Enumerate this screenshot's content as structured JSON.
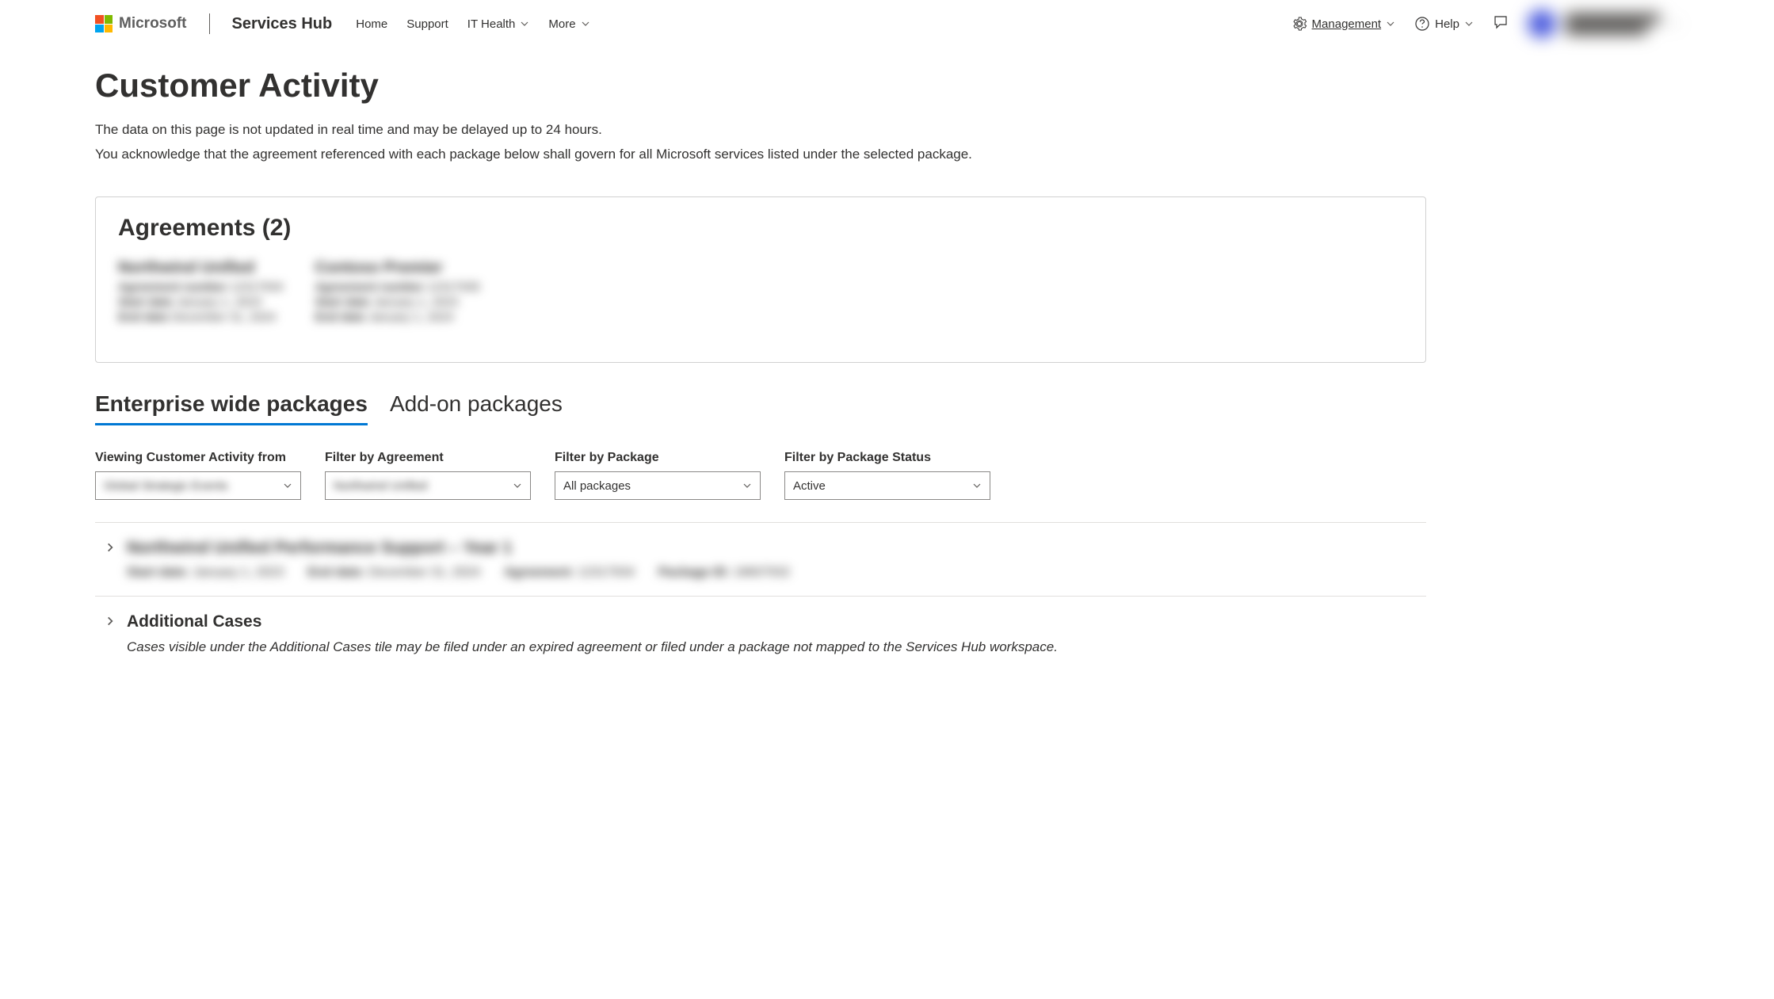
{
  "header": {
    "brand": "Microsoft",
    "app_name": "Services Hub",
    "nav": {
      "home": "Home",
      "support": "Support",
      "it_health": "IT Health",
      "more": "More",
      "management": "Management",
      "help": "Help"
    },
    "profile": {
      "line1": "██████████████",
      "line2": "████████████"
    }
  },
  "page": {
    "title": "Customer Activity",
    "subtitle1": "The data on this page is not updated in real time and may be delayed up to 24 hours.",
    "subtitle2": "You acknowledge that the agreement referenced with each package below shall govern for all Microsoft services listed under the selected package."
  },
  "agreements": {
    "title": "Agreements (2)",
    "items": [
      {
        "name": "Northwind Unified",
        "number_label": "Agreement number",
        "number": "12317934",
        "start_label": "Start date",
        "start": "January 1, 2023",
        "end_label": "End date",
        "end": "December 31, 2024"
      },
      {
        "name": "Contoso Premier",
        "number_label": "Agreement number",
        "number": "12317935",
        "start_label": "Start date",
        "start": "January 1, 2023",
        "end_label": "End date",
        "end": "January 1, 2024"
      }
    ]
  },
  "tabs": {
    "enterprise": "Enterprise wide packages",
    "addon": "Add-on packages"
  },
  "filters": {
    "viewing": {
      "label": "Viewing Customer Activity from",
      "value": "Global Strategic Events"
    },
    "agreement": {
      "label": "Filter by Agreement",
      "value": "Northwind Unified"
    },
    "package": {
      "label": "Filter by Package",
      "value": "All packages"
    },
    "status": {
      "label": "Filter by Package Status",
      "value": "Active"
    }
  },
  "packages": [
    {
      "title": "Northwind Unified Performance Support – Year 1",
      "start_label": "Start date:",
      "start": "January 1, 2023",
      "end_label": "End date:",
      "end": "December 31, 2024",
      "agreement_label": "Agreement:",
      "agreement": "12317934",
      "package_label": "Package ID:",
      "package_id": "18607932"
    },
    {
      "title": "Additional Cases",
      "desc": "Cases visible under the Additional Cases tile may be filed under an expired agreement or filed under a package not mapped to the Services Hub workspace."
    }
  ]
}
